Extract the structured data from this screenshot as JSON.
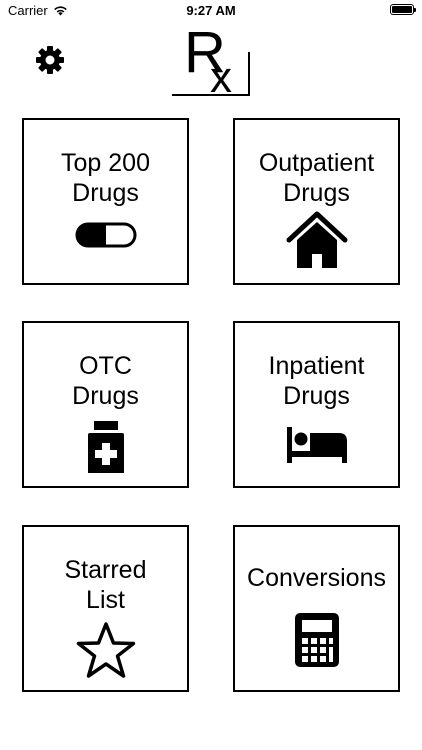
{
  "status_bar": {
    "carrier": "Carrier",
    "time": "9:27 AM"
  },
  "header": {
    "settings_icon": "gear-icon",
    "logo_text": "Rx"
  },
  "tiles": [
    {
      "line1": "Top 200",
      "line2": "Drugs",
      "icon": "pill-capsule-icon"
    },
    {
      "line1": "Outpatient",
      "line2": "Drugs",
      "icon": "house-icon"
    },
    {
      "line1": "OTC",
      "line2": "Drugs",
      "icon": "medicine-bottle-icon"
    },
    {
      "line1": "Inpatient",
      "line2": "Drugs",
      "icon": "bed-icon"
    },
    {
      "line1": "Starred",
      "line2": "List",
      "icon": "star-icon"
    },
    {
      "line1": "Conversions",
      "line2": "",
      "icon": "calculator-icon"
    }
  ],
  "colors": {
    "foreground": "#000000",
    "background": "#ffffff"
  }
}
